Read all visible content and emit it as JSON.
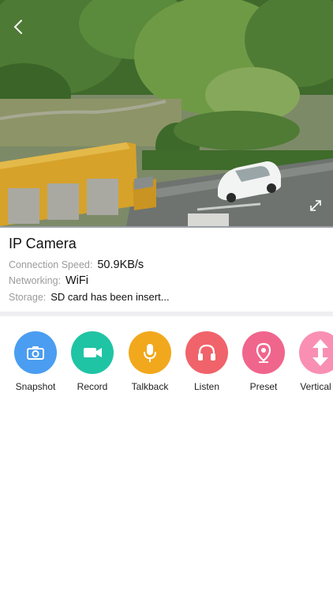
{
  "device": {
    "name": "IP Camera"
  },
  "info": {
    "connection_label": "Connection Speed:",
    "connection_value": "50.9KB/s",
    "networking_label": "Networking:",
    "networking_value": "WiFi",
    "storage_label": "Storage:",
    "storage_value": "SD card has been insert..."
  },
  "actions": [
    {
      "label": "Snapshot",
      "icon": "camera-icon",
      "color": "#4a9df0"
    },
    {
      "label": "Record",
      "icon": "video-camera-icon",
      "color": "#1fc4a4"
    },
    {
      "label": "Talkback",
      "icon": "microphone-icon",
      "color": "#f2a81c"
    },
    {
      "label": "Listen",
      "icon": "headphones-icon",
      "color": "#f0636a"
    },
    {
      "label": "Preset",
      "icon": "location-pin-icon",
      "color": "#f0658c"
    },
    {
      "label": "Vertical C",
      "icon": "vertical-arrows-icon",
      "color": "#f990b4"
    }
  ]
}
